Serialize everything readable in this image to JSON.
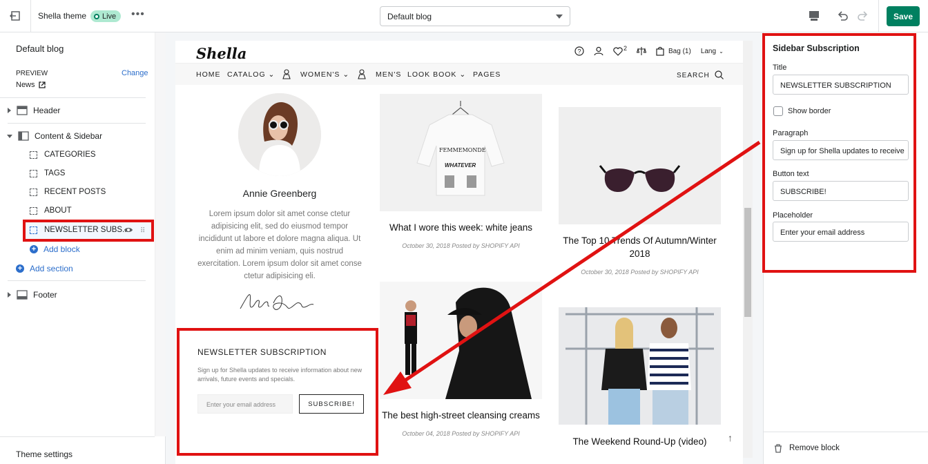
{
  "topbar": {
    "theme_name": "Shella theme",
    "status": "Live",
    "more": "•••",
    "page_select": "Default blog",
    "save": "Save"
  },
  "left": {
    "title": "Default blog",
    "preview_label": "PREVIEW",
    "change": "Change",
    "preview_page": "News",
    "sections": {
      "header": "Header",
      "content": "Content & Sidebar",
      "footer": "Footer"
    },
    "blocks": [
      "CATEGORIES",
      "TAGS",
      "RECENT POSTS",
      "ABOUT"
    ],
    "active_block": "NEWSLETTER SUBS...",
    "add_block": "Add block",
    "add_section": "Add section",
    "theme_settings": "Theme settings"
  },
  "preview": {
    "logo": "Shella",
    "wishlist_count": "2",
    "bag": "Bag (1)",
    "lang": "Lang",
    "nav": [
      "HOME",
      "CATALOG",
      "WOMEN'S",
      "MEN'S",
      "LOOK BOOK",
      "PAGES"
    ],
    "search": "SEARCH",
    "author": {
      "name": "Annie Greenberg",
      "bio": "Lorem ipsum dolor sit amet conse ctetur adipisicing elit, sed do eiusmod tempor incididunt ut labore et dolore magna aliqua. Ut enim ad minim veniam, quis nostrud exercitation. Lorem ipsum dolor sit amet conse ctetur adipisicing eli.",
      "signature": "Annie Greenberg"
    },
    "newsletter": {
      "title": "NEWSLETTER SUBSCRIPTION",
      "paragraph": "Sign up for Shella updates to receive information about new arrivals, future events and specials.",
      "placeholder": "Enter your email address",
      "button": "SUBSCRIBE!"
    },
    "posts": [
      {
        "title": "What I wore this week: white jeans",
        "meta": "October 30, 2018 Posted by SHOPIFY API"
      },
      {
        "title": "The Top 10 Trends Of Autumn/Winter 2018",
        "meta": "October 30, 2018 Posted by SHOPIFY API"
      },
      {
        "title": "The best high-street cleansing creams",
        "meta": "October 04, 2018 Posted by SHOPIFY API"
      },
      {
        "title": "The Weekend Round-Up (video)",
        "meta": ""
      }
    ],
    "shirt_text": {
      "brand": "FEMMEMONDE",
      "word": "WHATEVER"
    }
  },
  "right": {
    "title": "Sidebar Subscription",
    "title_label": "Title",
    "title_value": "NEWSLETTER SUBSCRIPTION",
    "show_border": "Show border",
    "paragraph_label": "Paragraph",
    "paragraph_value": "Sign up for Shella updates to receive",
    "button_label": "Button text",
    "button_value": "SUBSCRIBE!",
    "placeholder_label": "Placeholder",
    "placeholder_value": "Enter your email address",
    "remove": "Remove block"
  },
  "colors": {
    "save": "#008060",
    "highlight": "#e01212",
    "link": "#2c6ecb"
  }
}
